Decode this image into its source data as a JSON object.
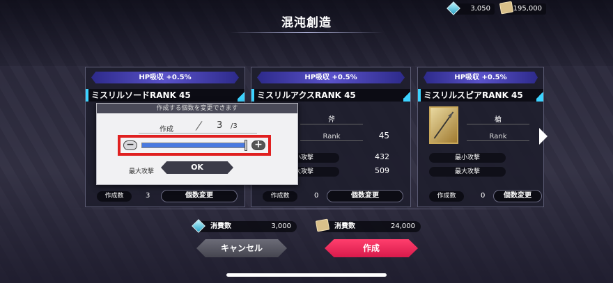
{
  "header": {
    "title": "混沌創造",
    "gems": "3,050",
    "gold": "195,000"
  },
  "cards": [
    {
      "hp_bonus": "HP吸収 +0.5%",
      "name": "ミスリルソードRANK 45",
      "type": "",
      "rank_label": "",
      "rank_value": "",
      "min_attack_label": "",
      "min_attack_value": "",
      "max_attack_label": "最大攻撃",
      "max_attack_value": "",
      "count_label": "作成数",
      "count_value": "3",
      "change_label": "個数変更"
    },
    {
      "hp_bonus": "HP吸収 +0.5%",
      "name": "ミスリルアクスRANK 45",
      "type": "斧",
      "rank_label": "Rank",
      "rank_value": "45",
      "min_attack_label": "最小攻撃",
      "min_attack_value": "432",
      "max_attack_label": "最大攻撃",
      "max_attack_value": "509",
      "count_label": "作成数",
      "count_value": "0",
      "change_label": "個数変更"
    },
    {
      "hp_bonus": "HP吸収 +0.5%",
      "name": "ミスリルスピアRANK 45",
      "type": "槍",
      "rank_label": "Rank",
      "rank_value": "",
      "min_attack_label": "最小攻撃",
      "min_attack_value": "",
      "max_attack_label": "最大攻撃",
      "max_attack_value": "",
      "count_label": "作成数",
      "count_value": "0",
      "change_label": "個数変更"
    }
  ],
  "popup": {
    "heading": "作成する個数を変更できます",
    "make_label": "作成",
    "current": "3",
    "max": "/3",
    "slider_fraction": 1.0,
    "ok_label": "OK"
  },
  "footer": {
    "cost_label_gems": "消費数",
    "cost_value_gems": "3,000",
    "cost_label_gold": "消費数",
    "cost_value_gold": "24,000",
    "cancel_label": "キャンセル",
    "create_label": "作成"
  },
  "colors": {
    "accent_cyan": "#3cd3ff",
    "create_pink": "#ff3f6d",
    "highlight_red": "#e02020",
    "slider_blue": "#4a7ae0"
  }
}
